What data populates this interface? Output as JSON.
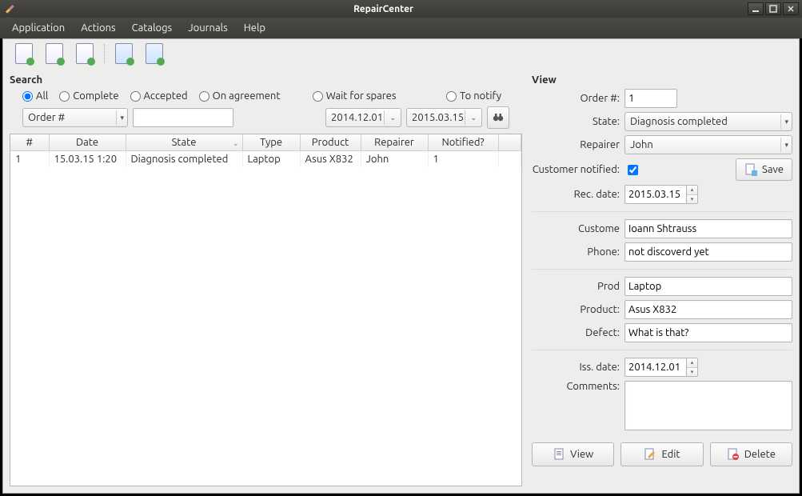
{
  "window": {
    "title": "RepairCenter"
  },
  "menu": {
    "items": [
      "Application",
      "Actions",
      "Catalogs",
      "Journals",
      "Help"
    ]
  },
  "toolbar_icons": [
    "new-doc",
    "import-doc",
    "export-doc",
    "sync-doc",
    "refresh-doc"
  ],
  "search": {
    "title": "Search",
    "radios": [
      {
        "id": "all",
        "label": "All",
        "checked": true
      },
      {
        "id": "complete",
        "label": "Complete",
        "checked": false
      },
      {
        "id": "accepted",
        "label": "Accepted",
        "checked": false
      },
      {
        "id": "on_agreement",
        "label": "On agreement",
        "checked": false
      },
      {
        "id": "wait_spares",
        "label": "Wait for spares",
        "checked": false
      },
      {
        "id": "to_notify",
        "label": "To notify",
        "checked": false
      }
    ],
    "field_select": "Order #",
    "field_value": "",
    "date_from": "2014.12.01",
    "date_to": "2015.03.15"
  },
  "table": {
    "columns": [
      "#",
      "Date",
      "State",
      "Type",
      "Product",
      "Repairer",
      "Notified?"
    ],
    "sorted_col": 2,
    "rows": [
      {
        "num": "1",
        "date": "15.03.15 1:20",
        "state": "Diagnosis completed",
        "type": "Laptop",
        "product": "Asus X832",
        "repairer": "John",
        "notified": "1"
      }
    ]
  },
  "view": {
    "title": "View",
    "order_no_label": "Order #:",
    "order_no": "1",
    "state_label": "State:",
    "state": "Diagnosis completed",
    "repairer_label": "Repairer",
    "repairer": "John",
    "notified_label": "Customer notified:",
    "notified": true,
    "save_label": "Save",
    "rec_date_label": "Rec. date:",
    "rec_date": "2015.03.15",
    "customer_label": "Custome",
    "customer": "Ioann Shtrauss",
    "phone_label": "Phone:",
    "phone": "not discoverd yet",
    "prod_type_label": "Prod",
    "prod_type": "Laptop",
    "product_label": "Product:",
    "product": "Asus X832",
    "defect_label": "Defect:",
    "defect": "What is that?",
    "iss_date_label": "Iss. date:",
    "iss_date": "2014.12.01",
    "comments_label": "Comments:",
    "comments": "",
    "view_btn": "View",
    "edit_btn": "Edit",
    "delete_btn": "Delete"
  }
}
